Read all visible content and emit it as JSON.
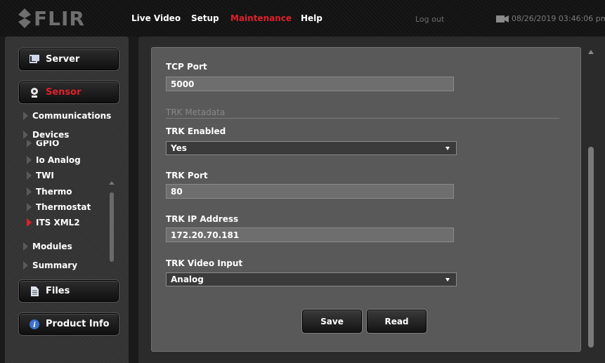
{
  "brand": {
    "logo_text": "FLIR"
  },
  "nav": {
    "items": [
      {
        "label": "Live Video",
        "active": false
      },
      {
        "label": "Setup",
        "active": false
      },
      {
        "label": "Maintenance",
        "active": true
      },
      {
        "label": "Help",
        "active": false
      }
    ],
    "logout_label": "Log out",
    "datetime": "08/26/2019 03:46:06 pm"
  },
  "sidebar": {
    "server_label": "Server",
    "sensor_label": "Sensor",
    "communications_label": "Communications",
    "devices_label": "Devices",
    "device_items": [
      "GPIO",
      "Io Analog",
      "TWI",
      "Thermo",
      "Thermostat",
      "ITS XML2"
    ],
    "modules_label": "Modules",
    "summary_label": "Summary",
    "files_label": "Files",
    "product_info_label": "Product Info"
  },
  "form": {
    "tcp_port_label": "TCP Port",
    "tcp_port_value": "5000",
    "section_title": "TRK Metadata",
    "trk_enabled_label": "TRK Enabled",
    "trk_enabled_value": "Yes",
    "trk_port_label": "TRK Port",
    "trk_port_value": "80",
    "trk_ip_label": "TRK IP Address",
    "trk_ip_value": "172.20.70.181",
    "trk_video_input_label": "TRK Video Input",
    "trk_video_input_value": "Analog",
    "save_label": "Save",
    "read_label": "Read"
  },
  "colors": {
    "accent_red": "#e0202a",
    "panel_gray": "#595959",
    "background": "#1a1a1a"
  }
}
